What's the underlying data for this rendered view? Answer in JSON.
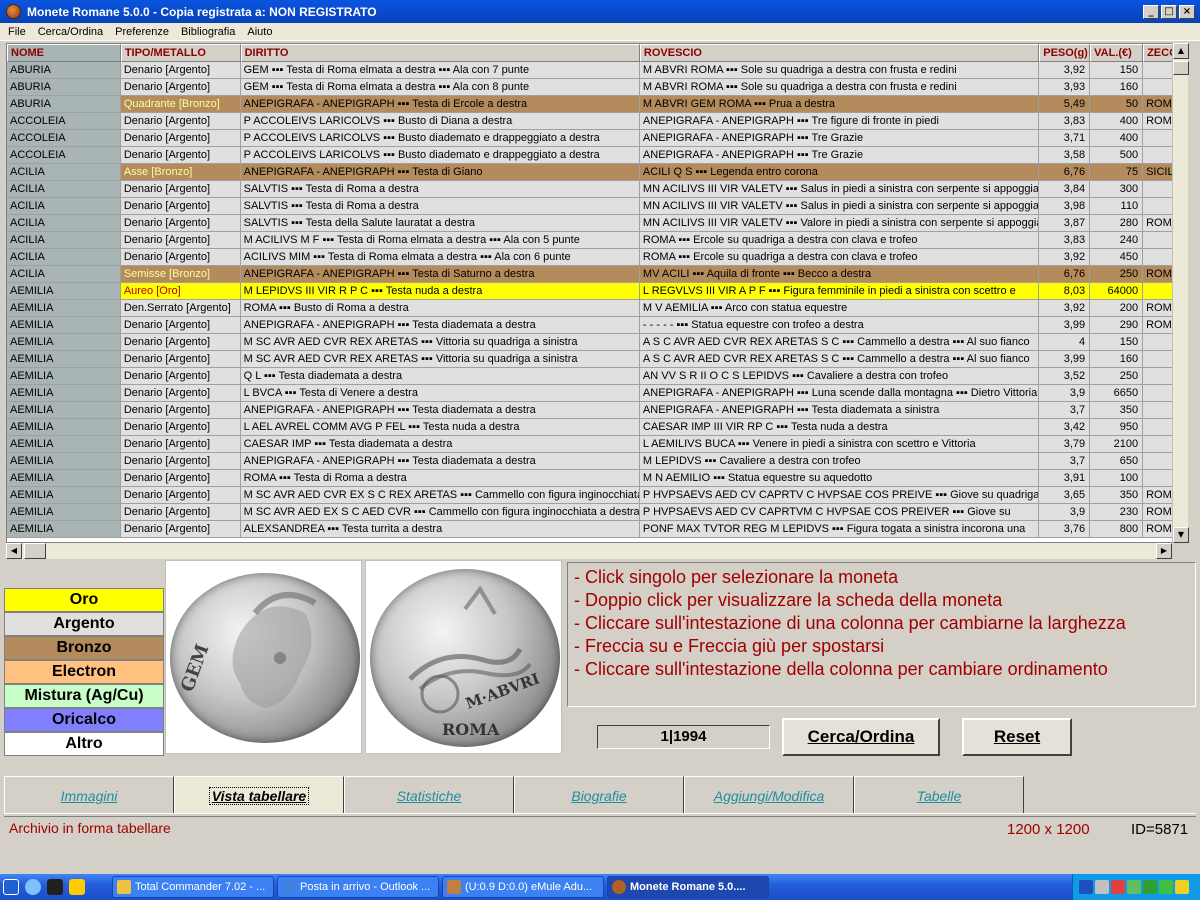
{
  "window": {
    "title": "Monete Romane 5.0.0 - Copia registrata a:  NON REGISTRATO"
  },
  "menu": [
    "File",
    "Cerca/Ordina",
    "Preferenze",
    "Bibliografia",
    "Aiuto"
  ],
  "table": {
    "columns": [
      "NOME",
      "TIPO/METALLO",
      "DIRITTO",
      "ROVESCIO",
      "PESO(g)",
      "VAL.(€)",
      "ZECCA"
    ],
    "rows": [
      {
        "metal": "argento",
        "nome": "ABURIA",
        "tipo": "Denario [Argento]",
        "diritto": "GEM ▪▪▪ Testa di Roma elmata a destra ▪▪▪ Ala con 7 punte",
        "rovescio": "M ABVRI ROMA ▪▪▪ Sole su quadriga a destra con frusta e redini",
        "peso": "3,92",
        "val": "150",
        "zecca": ""
      },
      {
        "metal": "argento",
        "nome": "ABURIA",
        "tipo": "Denario [Argento]",
        "diritto": "GEM ▪▪▪ Testa di Roma elmata a destra ▪▪▪ Ala con 8 punte",
        "rovescio": "M ABVRI ROMA ▪▪▪ Sole su quadriga a destra con frusta e redini",
        "peso": "3,93",
        "val": "160",
        "zecca": ""
      },
      {
        "metal": "bronzo",
        "nome": "ABURIA",
        "tipo": "Quadrante [Bronzo]",
        "diritto": "ANEPIGRAFA - ANEPIGRAPH ▪▪▪ Testa di Ercole a destra",
        "rovescio": "M ABVRI GEM ROMA ▪▪▪ Prua a destra",
        "peso": "5,49",
        "val": "50",
        "zecca": "ROMA"
      },
      {
        "metal": "argento",
        "nome": "ACCOLEIA",
        "tipo": "Denario [Argento]",
        "diritto": "P ACCOLEIVS LARICOLVS ▪▪▪ Busto di Diana a destra",
        "rovescio": "ANEPIGRAFA - ANEPIGRAPH ▪▪▪ Tre figure di fronte in piedi",
        "peso": "3,83",
        "val": "400",
        "zecca": "ROMA"
      },
      {
        "metal": "argento",
        "nome": "ACCOLEIA",
        "tipo": "Denario [Argento]",
        "diritto": "P ACCOLEIVS LARICOLVS ▪▪▪ Busto diademato e drappeggiato a destra",
        "rovescio": "ANEPIGRAFA - ANEPIGRAPH ▪▪▪ Tre Grazie",
        "peso": "3,71",
        "val": "400",
        "zecca": ""
      },
      {
        "metal": "argento",
        "nome": "ACCOLEIA",
        "tipo": "Denario [Argento]",
        "diritto": "P ACCOLEIVS LARICOLVS ▪▪▪ Busto diademato e drappeggiato a destra",
        "rovescio": "ANEPIGRAFA - ANEPIGRAPH ▪▪▪ Tre Grazie",
        "peso": "3,58",
        "val": "500",
        "zecca": ""
      },
      {
        "metal": "bronzo",
        "nome": "ACILIA",
        "tipo": "Asse [Bronzo]",
        "diritto": "ANEPIGRAFA - ANEPIGRAPH ▪▪▪ Testa di Giano",
        "rovescio": "ACILI Q S ▪▪▪ Legenda entro corona",
        "peso": "6,76",
        "val": "75",
        "zecca": "SICILIA"
      },
      {
        "metal": "argento",
        "nome": "ACILIA",
        "tipo": "Denario [Argento]",
        "diritto": "SALVTIS ▪▪▪ Testa di Roma a destra",
        "rovescio": "MN ACILIVS III VIR VALETV ▪▪▪ Salus in piedi a sinistra con serpente si appoggia",
        "peso": "3,84",
        "val": "300",
        "zecca": ""
      },
      {
        "metal": "argento",
        "nome": "ACILIA",
        "tipo": "Denario [Argento]",
        "diritto": "SALVTIS ▪▪▪ Testa di Roma a destra",
        "rovescio": "MN ACILIVS III VIR VALETV ▪▪▪ Salus in piedi a sinistra con serpente si appoggia",
        "peso": "3,98",
        "val": "110",
        "zecca": ""
      },
      {
        "metal": "argento",
        "nome": "ACILIA",
        "tipo": "Denario [Argento]",
        "diritto": "SALVTIS ▪▪▪ Testa della Salute lauratat a destra",
        "rovescio": "MN ACILIVS III VIR VALETV ▪▪▪ Valore in piedi a sinistra con serpente si appoggia",
        "peso": "3,87",
        "val": "280",
        "zecca": "ROMA"
      },
      {
        "metal": "argento",
        "nome": "ACILIA",
        "tipo": "Denario [Argento]",
        "diritto": "M ACILIVS M F ▪▪▪ Testa di Roma elmata a destra ▪▪▪ Ala con 5 punte",
        "rovescio": "ROMA ▪▪▪ Ercole su quadriga a destra con clava e trofeo",
        "peso": "3,83",
        "val": "240",
        "zecca": ""
      },
      {
        "metal": "argento",
        "nome": "ACILIA",
        "tipo": "Denario [Argento]",
        "diritto": "ACILIVS MIM ▪▪▪ Testa di Roma elmata a destra ▪▪▪ Ala con 6 punte",
        "rovescio": "ROMA ▪▪▪ Ercole su quadriga a destra con clava e trofeo",
        "peso": "3,92",
        "val": "450",
        "zecca": ""
      },
      {
        "metal": "bronzo",
        "nome": "ACILIA",
        "tipo": "Semisse [Bronzo]",
        "diritto": "ANEPIGRAFA - ANEPIGRAPH ▪▪▪ Testa di Saturno a destra",
        "rovescio": "MV ACILI ▪▪▪ Aquila di fronte ▪▪▪ Becco a destra",
        "peso": "6,76",
        "val": "250",
        "zecca": "ROMA"
      },
      {
        "metal": "oro",
        "nome": "AEMILIA",
        "tipo": "Aureo [Oro]",
        "diritto": "M LEPIDVS III VIR R P C ▪▪▪ Testa nuda a destra",
        "rovescio": "L REGVLVS III VIR A P F ▪▪▪ Figura femminile in piedi a sinistra con scettro e",
        "peso": "8,03",
        "val": "64000",
        "zecca": ""
      },
      {
        "metal": "argento",
        "nome": "AEMILIA",
        "tipo": "Den.Serrato [Argento]",
        "diritto": "ROMA ▪▪▪ Busto di Roma a destra",
        "rovescio": "M V AEMILIA ▪▪▪ Arco con statua equestre",
        "peso": "3,92",
        "val": "200",
        "zecca": "ROMA"
      },
      {
        "metal": "argento",
        "nome": "AEMILIA",
        "tipo": "Denario [Argento]",
        "diritto": "ANEPIGRAFA - ANEPIGRAPH ▪▪▪ Testa diademata a destra",
        "rovescio": "- - - - - ▪▪▪ Statua equestre con trofeo a destra",
        "peso": "3,99",
        "val": "290",
        "zecca": "ROMA"
      },
      {
        "metal": "argento",
        "nome": "AEMILIA",
        "tipo": "Denario [Argento]",
        "diritto": "M SC AVR AED CVR REX ARETAS ▪▪▪ Vittoria su quadriga a sinistra",
        "rovescio": "A S C AVR AED CVR REX ARETAS S C ▪▪▪ Cammello a destra ▪▪▪ Al suo fianco",
        "peso": "4",
        "val": "150",
        "zecca": ""
      },
      {
        "metal": "argento",
        "nome": "AEMILIA",
        "tipo": "Denario [Argento]",
        "diritto": "M SC AVR AED CVR REX ARETAS ▪▪▪ Vittoria su quadriga a sinistra",
        "rovescio": "A S C AVR AED CVR REX ARETAS S C ▪▪▪ Cammello a destra ▪▪▪ Al suo fianco",
        "peso": "3,99",
        "val": "160",
        "zecca": ""
      },
      {
        "metal": "argento",
        "nome": "AEMILIA",
        "tipo": "Denario [Argento]",
        "diritto": "Q L ▪▪▪ Testa diademata a destra",
        "rovescio": "AN VV S R II O C S LEPIDVS ▪▪▪ Cavaliere a destra con trofeo",
        "peso": "3,52",
        "val": "250",
        "zecca": ""
      },
      {
        "metal": "argento",
        "nome": "AEMILIA",
        "tipo": "Denario [Argento]",
        "diritto": "L BVCA ▪▪▪ Testa di Venere a destra",
        "rovescio": "ANEPIGRAFA - ANEPIGRAPH ▪▪▪ Luna scende dalla montagna ▪▪▪ Dietro Vittoria",
        "peso": "3,9",
        "val": "6650",
        "zecca": ""
      },
      {
        "metal": "argento",
        "nome": "AEMILIA",
        "tipo": "Denario [Argento]",
        "diritto": "ANEPIGRAFA - ANEPIGRAPH ▪▪▪ Testa diademata a destra",
        "rovescio": "ANEPIGRAFA - ANEPIGRAPH ▪▪▪ Testa diademata a sinistra",
        "peso": "3,7",
        "val": "350",
        "zecca": ""
      },
      {
        "metal": "argento",
        "nome": "AEMILIA",
        "tipo": "Denario [Argento]",
        "diritto": "L AEL AVREL COMM AVG P FEL ▪▪▪ Testa nuda a destra",
        "rovescio": "CAESAR IMP III VIR RP C ▪▪▪ Testa nuda a destra",
        "peso": "3,42",
        "val": "950",
        "zecca": ""
      },
      {
        "metal": "argento",
        "nome": "AEMILIA",
        "tipo": "Denario [Argento]",
        "diritto": "CAESAR IMP ▪▪▪ Testa diademata a destra",
        "rovescio": "L AEMILIVS BUCA ▪▪▪ Venere in piedi a sinistra con scettro e Vittoria",
        "peso": "3,79",
        "val": "2100",
        "zecca": ""
      },
      {
        "metal": "argento",
        "nome": "AEMILIA",
        "tipo": "Denario [Argento]",
        "diritto": "ANEPIGRAFA - ANEPIGRAPH ▪▪▪ Testa diademata a destra",
        "rovescio": "M LEPIDVS ▪▪▪ Cavaliere a destra con trofeo",
        "peso": "3,7",
        "val": "650",
        "zecca": ""
      },
      {
        "metal": "argento",
        "nome": "AEMILIA",
        "tipo": "Denario [Argento]",
        "diritto": "ROMA ▪▪▪ Testa di Roma a destra",
        "rovescio": "M N AEMILIO ▪▪▪ Statua equestre su aquedotto",
        "peso": "3,91",
        "val": "100",
        "zecca": ""
      },
      {
        "metal": "argento",
        "nome": "AEMILIA",
        "tipo": "Denario [Argento]",
        "diritto": "M SC AVR AED CVR EX S C REX ARETAS ▪▪▪ Cammello con figura inginocchiata",
        "rovescio": "P HVPSAEVS AED CV CAPRTV C HVPSAE COS PREIVE ▪▪▪ Giove su quadriga a",
        "peso": "3,65",
        "val": "350",
        "zecca": "ROMA"
      },
      {
        "metal": "argento",
        "nome": "AEMILIA",
        "tipo": "Denario [Argento]",
        "diritto": "M SC AVR AED EX S C AED CVR ▪▪▪ Cammello con figura inginocchiata a destra",
        "rovescio": "P HVPSAEVS AED CV CAPRTVM C HVPSAE COS PREIVER ▪▪▪ Giove su",
        "peso": "3,9",
        "val": "230",
        "zecca": "ROMA"
      },
      {
        "metal": "argento",
        "nome": "AEMILIA",
        "tipo": "Denario [Argento]",
        "diritto": "ALEXSANDREA ▪▪▪ Testa turrita a destra",
        "rovescio": "PONF MAX TVTOR REG M LEPIDVS ▪▪▪ Figura togata a sinistra incorona una",
        "peso": "3,76",
        "val": "800",
        "zecca": "ROMA"
      }
    ]
  },
  "legend": [
    {
      "label": "Oro",
      "color": "#ffff00"
    },
    {
      "label": "Argento",
      "color": "#e0e0e0"
    },
    {
      "label": "Bronzo",
      "color": "#b38b5d"
    },
    {
      "label": "Electron",
      "color": "#ffc080"
    },
    {
      "label": "Mistura (Ag/Cu)",
      "color": "#c8ffc8"
    },
    {
      "label": "Oricalco",
      "color": "#8080ff"
    },
    {
      "label": "Altro",
      "color": "#ffffff"
    }
  ],
  "coins": {
    "obverse_text": "GEM",
    "reverse_text_1": "M·ABVRI",
    "reverse_text_2": "ROMA"
  },
  "instructions": [
    "- Click singolo per selezionare la moneta",
    "- Doppio click per visualizzare la scheda della moneta",
    "- Cliccare sull'intestazione di una colonna per cambiarne la larghezza",
    "- Freccia su e Freccia giù per spostarsi",
    "- Cliccare sull'intestazione della colonna per cambiare ordinamento"
  ],
  "counter": "1|1994",
  "buttons": {
    "search": "Cerca/Ordina",
    "reset": "Reset"
  },
  "tabs": [
    "Immagini",
    "Vista tabellare",
    "Statistiche",
    "Biografie",
    "Aggiungi/Modifica",
    "Tabelle"
  ],
  "active_tab": "Vista tabellare",
  "status": {
    "left": "Archivio in forma tabellare",
    "resolution": "1200 x 1200",
    "id": "ID=5871"
  },
  "taskbar": {
    "tasks": [
      {
        "label": "Total Commander 7.02 - ...",
        "icon": "floppy-icon",
        "color": "#f0c040"
      },
      {
        "label": "Posta in arrivo - Outlook ...",
        "icon": "mail-icon",
        "color": "#4080e0"
      },
      {
        "label": "(U:0.9 D:0.0) eMule Adu...",
        "icon": "emule-icon",
        "color": "#c08040"
      },
      {
        "label": "Monete Romane 5.0....",
        "icon": "coin-icon",
        "color": "#b06020"
      }
    ]
  }
}
